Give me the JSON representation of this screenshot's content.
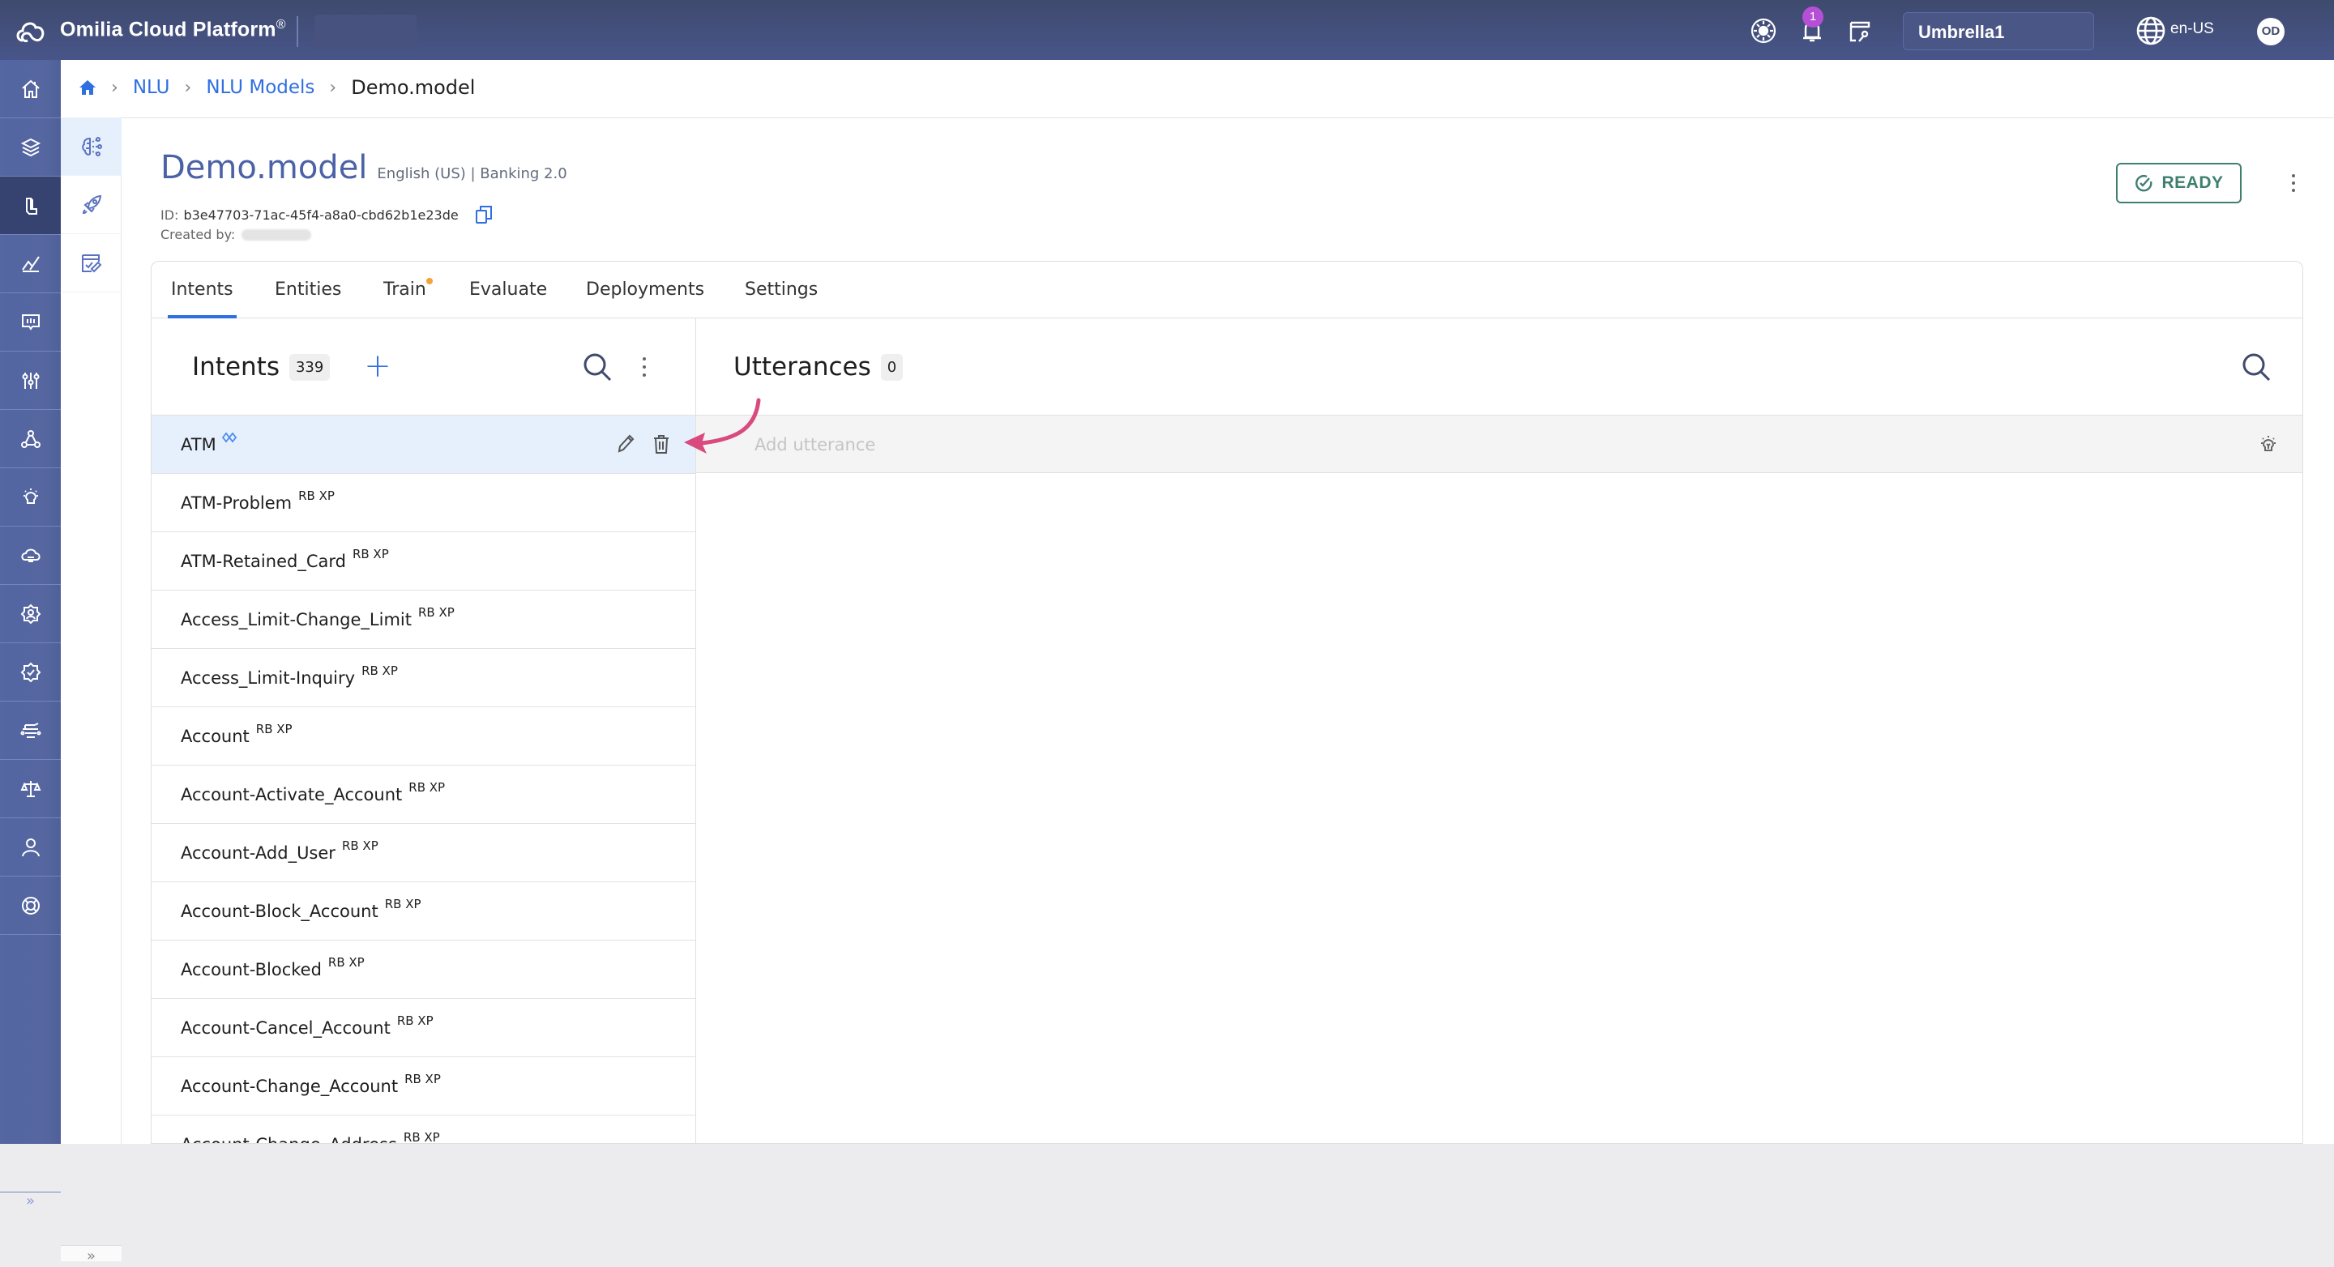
{
  "topbar": {
    "brand": "Omilia Cloud Platform",
    "brand_mark": "®",
    "notifications_count": "1",
    "tenant": "Umbrella1",
    "language": "en-US",
    "avatar_initials": "OD",
    "icons": [
      "cloud-logo-icon",
      "theme-toggle-icon",
      "bell-icon",
      "license-key-icon",
      "globe-icon"
    ]
  },
  "rail": {
    "items": [
      {
        "icon": "home-icon",
        "active": false
      },
      {
        "icon": "layers-icon",
        "active": false
      },
      {
        "icon": "nlu-icon",
        "active": true
      },
      {
        "icon": "analytics-icon",
        "active": false
      },
      {
        "icon": "conversation-insights-icon",
        "active": false
      },
      {
        "icon": "sliders-icon",
        "active": false
      },
      {
        "icon": "network-icon",
        "active": false
      },
      {
        "icon": "lightbulb-icon",
        "active": false
      },
      {
        "icon": "cloud-server-icon",
        "active": false
      },
      {
        "icon": "user-gear-icon",
        "active": false
      },
      {
        "icon": "verified-badge-icon",
        "active": false
      },
      {
        "icon": "circuit-icon",
        "active": false
      },
      {
        "icon": "scales-icon",
        "active": false
      },
      {
        "icon": "user-icon",
        "active": false
      },
      {
        "icon": "lifebuoy-icon",
        "active": false
      }
    ],
    "collapse_label": "»"
  },
  "subrail": {
    "items": [
      {
        "icon": "brain-icon",
        "active": true
      },
      {
        "icon": "rocket-icon",
        "active": false
      },
      {
        "icon": "checklist-edit-icon",
        "active": false
      }
    ],
    "collapse_label": "»"
  },
  "breadcrumb": {
    "items": [
      {
        "label": "NLU"
      },
      {
        "label": "NLU Models"
      }
    ],
    "current": "Demo.model",
    "separator": "›"
  },
  "model": {
    "name": "Demo.model",
    "subtitle": "English (US) | Banking 2.0",
    "id_label": "ID:",
    "id": "b3e47703-71ac-45f4-a8a0-cbd62b1e23de",
    "created_by_label": "Created by:",
    "status": "READY",
    "status_color": "#3f7f70"
  },
  "tabs": [
    {
      "label": "Intents",
      "active": true
    },
    {
      "label": "Entities",
      "active": false
    },
    {
      "label": "Train",
      "active": false,
      "dot": true
    },
    {
      "label": "Evaluate",
      "active": false
    },
    {
      "label": "Deployments",
      "active": false
    },
    {
      "label": "Settings",
      "active": false
    }
  ],
  "intents": {
    "title": "Intents",
    "count": "339",
    "add_label": "+",
    "items": [
      {
        "name": "ATM",
        "tags": "",
        "linked": true,
        "selected": true
      },
      {
        "name": "ATM-Problem",
        "tags": "RB XP"
      },
      {
        "name": "ATM-Retained_Card",
        "tags": "RB XP"
      },
      {
        "name": "Access_Limit-Change_Limit",
        "tags": "RB XP"
      },
      {
        "name": "Access_Limit-Inquiry",
        "tags": "RB XP"
      },
      {
        "name": "Account",
        "tags": "RB XP"
      },
      {
        "name": "Account-Activate_Account",
        "tags": "RB XP"
      },
      {
        "name": "Account-Add_User",
        "tags": "RB XP"
      },
      {
        "name": "Account-Block_Account",
        "tags": "RB XP"
      },
      {
        "name": "Account-Blocked",
        "tags": "RB XP"
      },
      {
        "name": "Account-Cancel_Account",
        "tags": "RB XP"
      },
      {
        "name": "Account-Change_Account",
        "tags": "RB XP"
      },
      {
        "name": "Account-Change_Address",
        "tags": "RB XP"
      }
    ]
  },
  "utterances": {
    "title": "Utterances",
    "count": "0",
    "input_placeholder": "Add utterance",
    "input_value": ""
  },
  "colors": {
    "accent": "#2f6fe0",
    "topbar": "#3e4a6d",
    "rail": "#5466a3",
    "rail_active": "#36426f",
    "selected_row": "#e6f0fc",
    "title": "#4b62a6",
    "annotation_arrow": "#d94a7e",
    "train_dot": "#f2a33a",
    "badge": "#b44fd6"
  }
}
